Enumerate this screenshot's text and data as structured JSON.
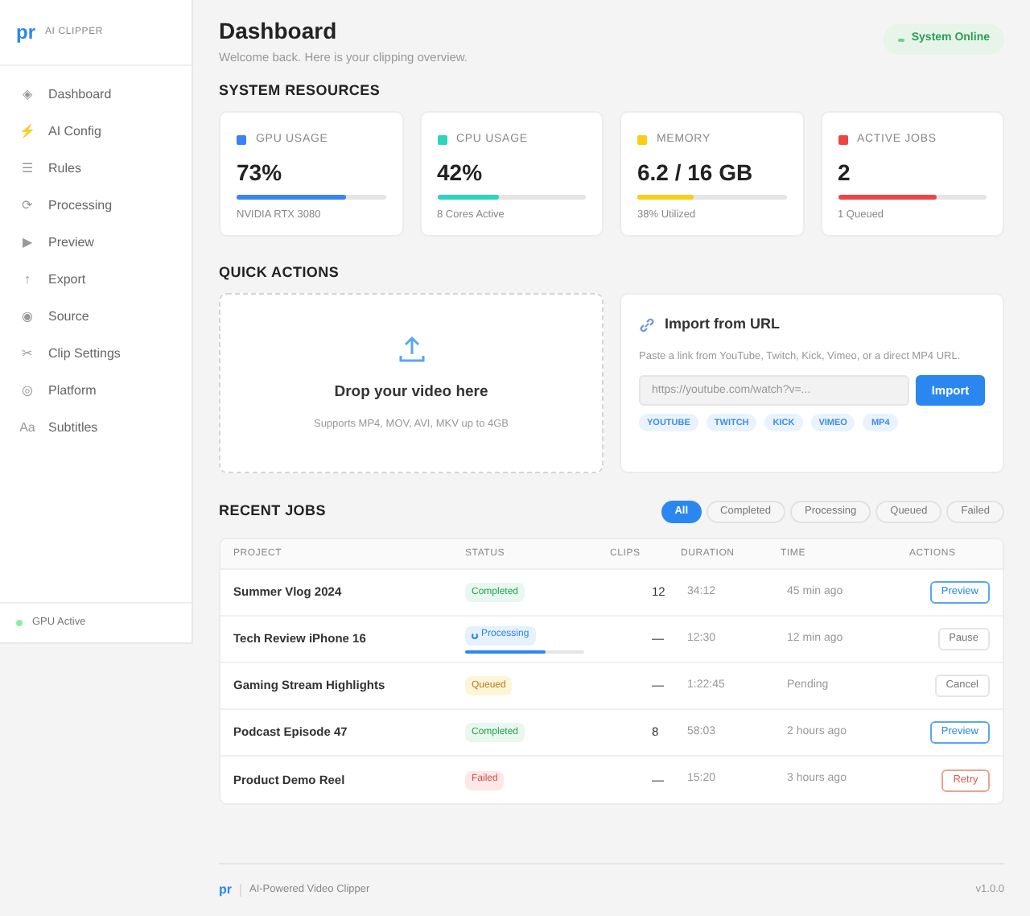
{
  "sidebar": {
    "logo": "pr",
    "app_name": "AI CLIPPER",
    "items": [
      {
        "icon": "◈",
        "label": "Dashboard"
      },
      {
        "icon": "⚡",
        "label": "AI Config"
      },
      {
        "icon": "☰",
        "label": "Rules"
      },
      {
        "icon": "⟳",
        "label": "Processing"
      },
      {
        "icon": "▶",
        "label": "Preview"
      },
      {
        "icon": "↑",
        "label": "Export"
      },
      {
        "icon": "◉",
        "label": "Source"
      },
      {
        "icon": "✂",
        "label": "Clip Settings"
      },
      {
        "icon": "◎",
        "label": "Platform"
      },
      {
        "icon": "Aa",
        "label": "Subtitles"
      }
    ],
    "status": {
      "label": "GPU Active",
      "color": "#86efac"
    }
  },
  "header": {
    "title": "Dashboard",
    "subtitle": "Welcome back. Here is your clipping overview.",
    "badge": "System Online"
  },
  "resources": {
    "title": "SYSTEM RESOURCES",
    "cards": [
      {
        "label": "GPU USAGE",
        "value": "73%",
        "level": 0.73,
        "note": "NVIDIA RTX 3080",
        "color": "#3b82f6"
      },
      {
        "label": "CPU USAGE",
        "value": "42%",
        "level": 0.42,
        "note": "8 Cores Active",
        "color": "#2dd4bf"
      },
      {
        "label": "MEMORY",
        "value": "6.2 / 16 GB",
        "level": 0.38,
        "note": "38% Utilized",
        "color": "#facc15"
      },
      {
        "label": "ACTIVE JOBS",
        "value": "2",
        "level": 0.66,
        "note": "1 Queued",
        "color": "#ef4444"
      }
    ]
  },
  "quick_actions": {
    "title": "QUICK ACTIONS",
    "drop": {
      "title": "Drop your video here",
      "note": "Supports MP4, MOV, AVI, MKV up to 4GB"
    },
    "import": {
      "title": "Import from URL",
      "hint": "Paste a link from YouTube, Twitch, Kick, Vimeo, or a direct MP4 URL.",
      "placeholder": "https://youtube.com/watch?v=...",
      "button": "Import",
      "tags": [
        "YOUTUBE",
        "TWITCH",
        "KICK",
        "VIMEO",
        "MP4"
      ]
    }
  },
  "recent_jobs": {
    "title": "RECENT JOBS",
    "filters": [
      {
        "label": "All",
        "selected": true
      },
      {
        "label": "Completed",
        "selected": false
      },
      {
        "label": "Processing",
        "selected": false
      },
      {
        "label": "Queued",
        "selected": false
      },
      {
        "label": "Failed",
        "selected": false
      }
    ],
    "columns": [
      "PROJECT",
      "STATUS",
      "CLIPS",
      "DURATION",
      "TIME",
      "ACTIONS"
    ],
    "rows": [
      {
        "project": "Summer Vlog 2024",
        "status": {
          "label": "Completed",
          "kind": "completed"
        },
        "clips": "12",
        "duration": "34:12",
        "time": "45 min ago",
        "action": {
          "label": "Preview",
          "kind": "primary"
        }
      },
      {
        "project": "Tech Review iPhone 16",
        "status": {
          "label": "Processing",
          "kind": "processing"
        },
        "level": 0.67,
        "clips": "—",
        "duration": "12:30",
        "time": "12 min ago",
        "action": {
          "label": "Pause",
          "kind": "neutral"
        }
      },
      {
        "project": "Gaming Stream Highlights",
        "status": {
          "label": "Queued",
          "kind": "queued"
        },
        "clips": "—",
        "duration": "1:22:45",
        "time": "Pending",
        "action": {
          "label": "Cancel",
          "kind": "neutral"
        }
      },
      {
        "project": "Podcast Episode 47",
        "status": {
          "label": "Completed",
          "kind": "completed"
        },
        "clips": "8",
        "duration": "58:03",
        "time": "2 hours ago",
        "action": {
          "label": "Preview",
          "kind": "primary"
        }
      },
      {
        "project": "Product Demo Reel",
        "status": {
          "label": "Failed",
          "kind": "failed"
        },
        "clips": "—",
        "duration": "15:20",
        "time": "3 hours ago",
        "action": {
          "label": "Retry",
          "kind": "danger"
        }
      }
    ]
  },
  "footer": {
    "logo": "pr",
    "text": "AI-Powered Video Clipper",
    "version": "v1.0.0"
  }
}
